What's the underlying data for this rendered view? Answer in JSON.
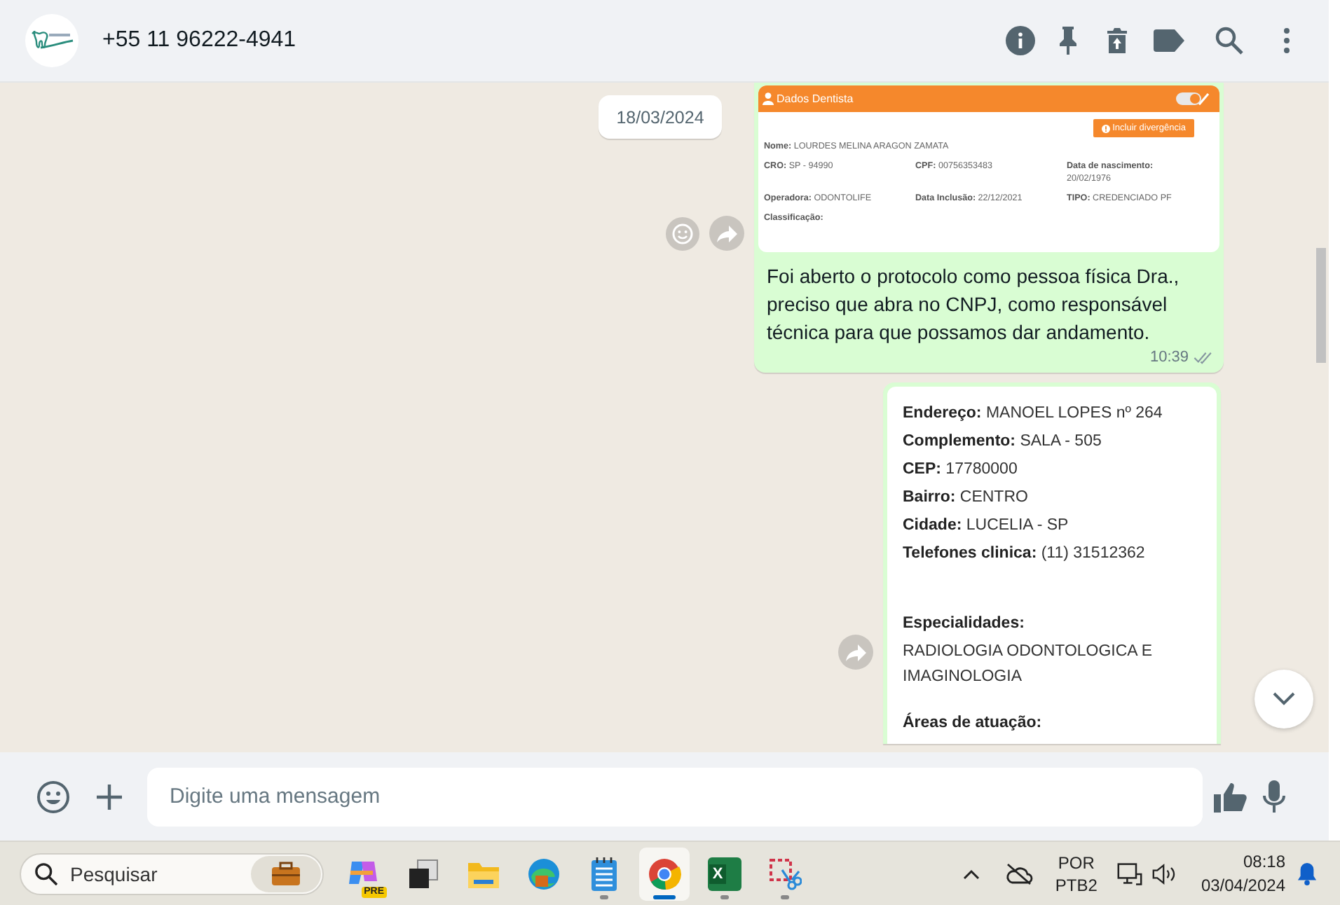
{
  "header": {
    "contact": "+55 11 96222-4941"
  },
  "date_badge": "18/03/2024",
  "messages": [
    {
      "kind": "form",
      "form": {
        "title": "Dados Dentista",
        "toggle": {
          "on": true
        },
        "button": "Incluir divergência",
        "name_field": {
          "label": "Nome:",
          "value": "LOURDES MELINA ARAGON ZAMATA"
        },
        "fields": [
          {
            "label": "CRO:",
            "value": "SP - 94990"
          },
          {
            "label": "CPF:",
            "value": "00756353483"
          },
          {
            "label": "Data de nascimento:",
            "value": "20/02/1976"
          },
          {
            "label": "Operadora:",
            "value": "ODONTOLIFE"
          },
          {
            "label": "Data Inclusão:",
            "value": "22/12/2021"
          },
          {
            "label": "TIPO:",
            "value": "CREDENCIADO PF"
          },
          {
            "label": "Classificação:"
          }
        ]
      },
      "text": "Foi aberto o protocolo como pessoa física Dra., preciso que abra no CNPJ, como responsável técnica para que possamos dar andamento.",
      "time": "10:39",
      "read": false
    },
    {
      "kind": "details",
      "lines": [
        {
          "label": "Endereço:",
          "value": "MANOEL LOPES nº 264"
        },
        {
          "label": "Complemento:",
          "value": "SALA - 505"
        },
        {
          "label": "CEP:",
          "value": "17780000"
        },
        {
          "label": "Bairro:",
          "value": "CENTRO"
        },
        {
          "label": "Cidade:",
          "value": "LUCELIA - SP"
        },
        {
          "label": "Telefones clinica:",
          "value": "(11) 31512362"
        }
      ],
      "sections": [
        {
          "heading": "Especialidades:",
          "value": "RADIOLOGIA ODONTOLOGICA E IMAGINOLOGIA"
        },
        {
          "heading": "Áreas de atuação:"
        }
      ]
    }
  ],
  "composer": {
    "placeholder": "Digite uma mensagem"
  },
  "taskbar": {
    "search": {
      "placeholder": "Pesquisar"
    },
    "apps": [
      {
        "kind": "copilot",
        "badge": "PRE",
        "running": false,
        "selected": false
      },
      {
        "kind": "taskview",
        "running": false,
        "selected": false
      },
      {
        "kind": "explorer",
        "running": false,
        "selected": false
      },
      {
        "kind": "edge",
        "running": false,
        "selected": false
      },
      {
        "kind": "notepad",
        "running": true,
        "selected": false
      },
      {
        "kind": "chrome",
        "running": true,
        "selected": true
      },
      {
        "kind": "excel",
        "label": "X",
        "running": true,
        "selected": false
      },
      {
        "kind": "snip",
        "running": true,
        "selected": false
      }
    ],
    "language": [
      "POR",
      "PTB2"
    ],
    "time": "08:18",
    "date": "03/04/2024"
  }
}
